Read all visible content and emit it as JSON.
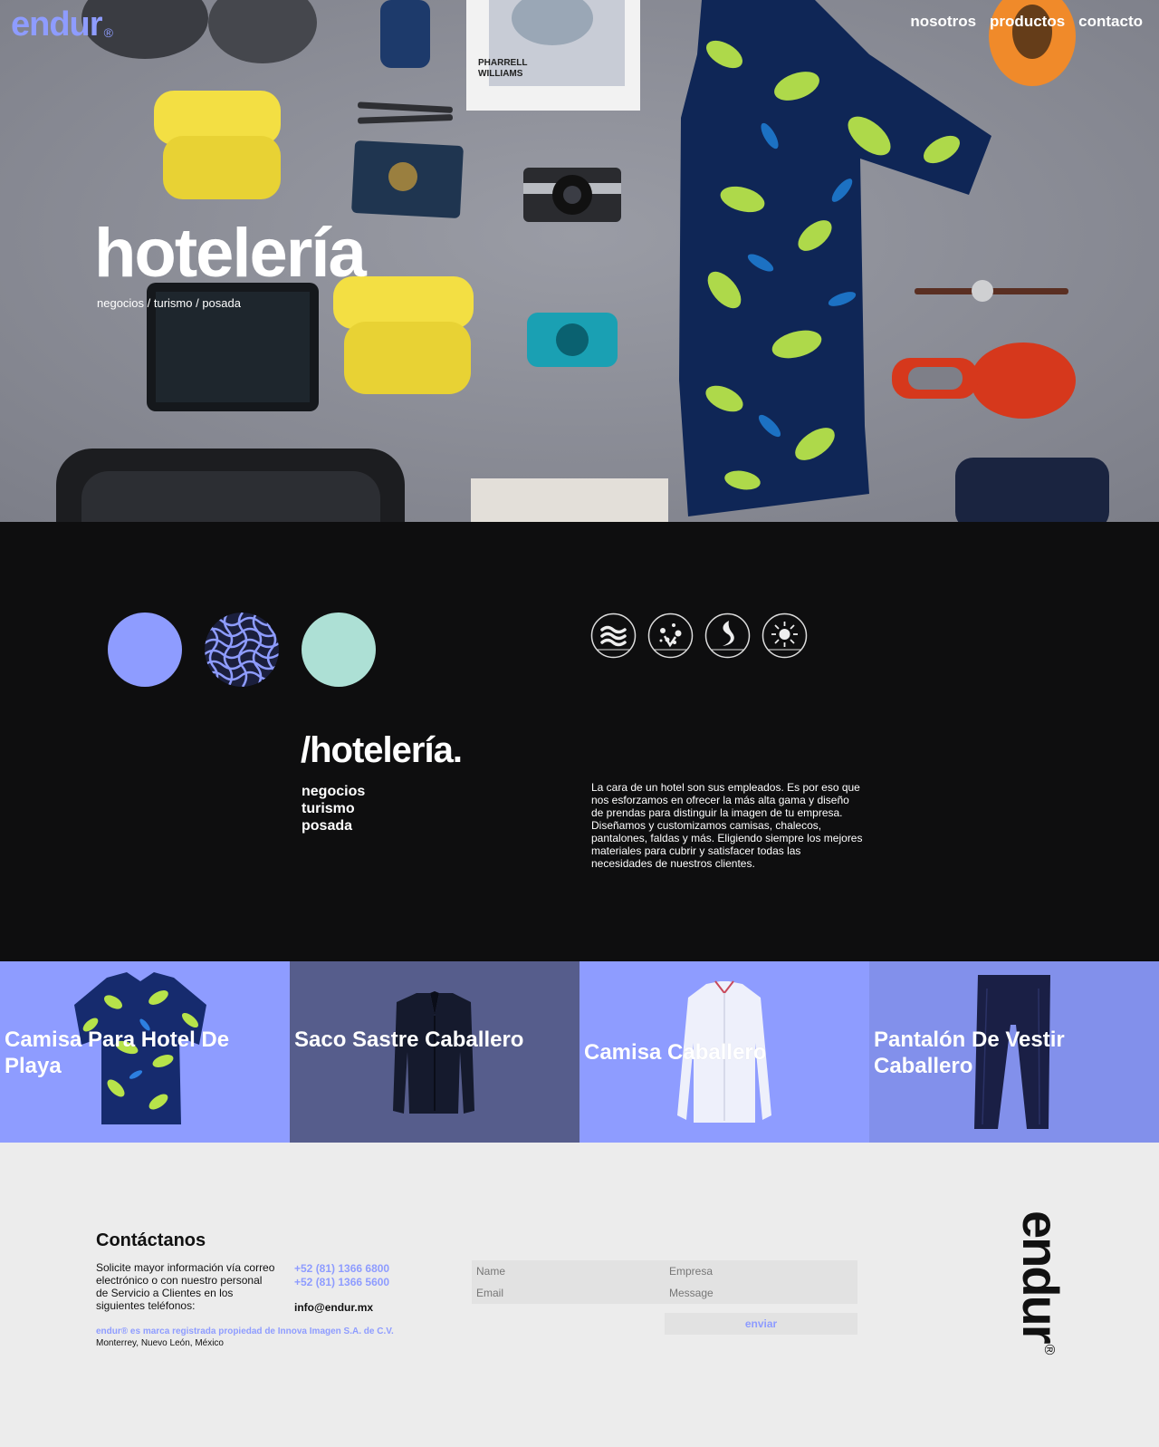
{
  "header": {
    "logo_text": "endur",
    "logo_mark": "®",
    "nav": [
      "nosotros",
      "productos",
      "contacto"
    ]
  },
  "hero": {
    "title": "hotelería",
    "subtitle": "negocios / turismo / posada"
  },
  "intro": {
    "title": "/hotelería.",
    "categories": [
      "negocios",
      "turismo",
      "posada"
    ],
    "description": "La cara de un hotel son sus empleados. Es por eso que nos esforzamos en ofrecer la más alta gama y diseño de prendas para distinguir la imagen de tu empresa. Diseñamos y customizamos camisas, chalecos, pantalones, faldas y más. Eligiendo siempre los mejores materiales para cubrir y satisfacer todas las necesidades de nuestros clientes.",
    "swatches": [
      "#8e9cff",
      "pattern",
      "#ade0d5"
    ],
    "feature_icons": [
      "waves-icon",
      "dots-icon",
      "flame-icon",
      "sun-icon"
    ]
  },
  "products": [
    {
      "name": "Camisa Para Hotel De Playa",
      "bg": "#8e9cff"
    },
    {
      "name": "Saco Sastre Caballero",
      "bg": "#565d8c"
    },
    {
      "name": "Camisa Caballero",
      "bg": "#8e9cff"
    },
    {
      "name": "Pantalón De Vestir Caballero",
      "bg": "#8290eb"
    }
  ],
  "contact": {
    "title": "Contáctanos",
    "text": "Solicite mayor información vía correo electrónico o con nuestro personal de Servicio a Clientes en los siguientes teléfonos:",
    "phones": [
      "+52 (81) 1366 6800",
      "+52 (81) 1366 5600"
    ],
    "email": "info@endur.mx",
    "trademark": "endur® es marca registrada propiedad de Innova Imagen S.A. de C.V.",
    "location": "Monterrey, Nuevo León, México",
    "form": {
      "name_placeholder": "Name",
      "company_placeholder": "Empresa",
      "email_placeholder": "Email",
      "message_placeholder": "Message",
      "submit_label": "enviar"
    },
    "side_logo": "endur",
    "side_logo_mark": "®"
  },
  "colors": {
    "accent": "#8e9cff",
    "mint": "#ade0d5",
    "dark": "#0e0e0f"
  }
}
